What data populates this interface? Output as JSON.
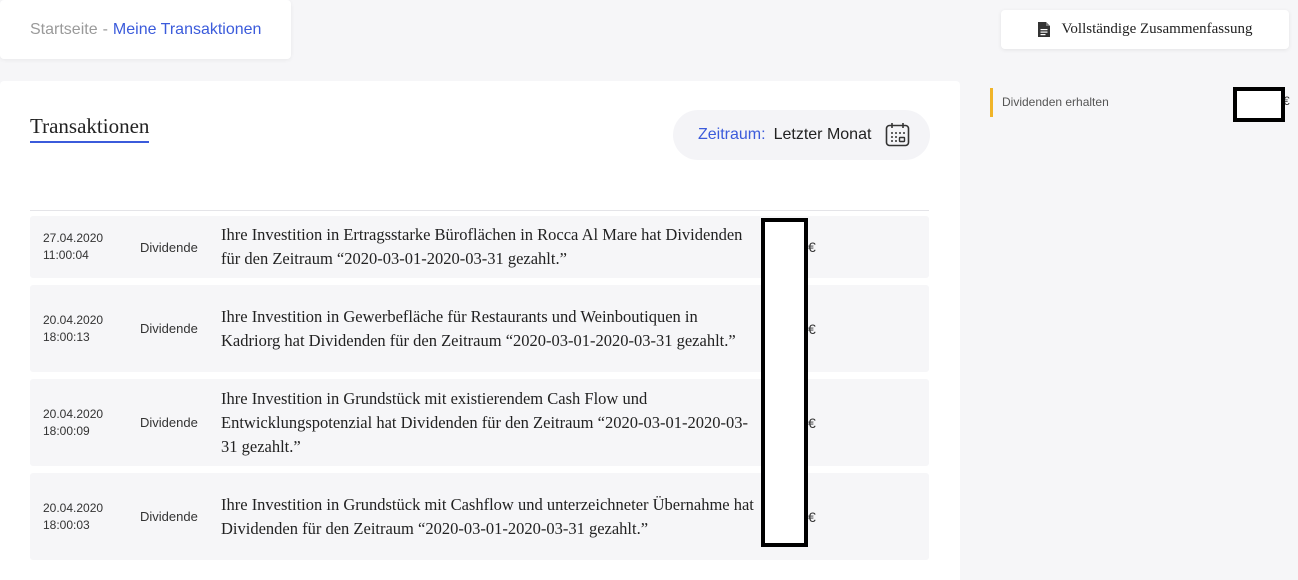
{
  "breadcrumb": {
    "home": "Startseite",
    "separator": "-",
    "current": "Meine Transaktionen"
  },
  "summary_button": {
    "label": "Vollständige Zusammenfassung",
    "icon": "document-icon"
  },
  "main": {
    "title": "Transaktionen",
    "period": {
      "label": "Zeitraum:",
      "value": "Letzter Monat",
      "icon": "calendar-icon"
    },
    "transactions": [
      {
        "date": "27.04.2020",
        "time": "11:00:04",
        "type": "Dividende",
        "description": "Ihre Investition in Ertragsstarke Büroflächen in Rocca Al Mare hat Dividenden für den Zeitraum “2020-03-01-2020-03-31 gezahlt.”",
        "currency": "€"
      },
      {
        "date": "20.04.2020",
        "time": "18:00:13",
        "type": "Dividende",
        "description": "Ihre Investition in Gewerbefläche für Restaurants und Weinboutiquen in Kadriorg hat Dividenden für den Zeitraum “2020-03-01-2020-03-31 gezahlt.”",
        "currency": "€"
      },
      {
        "date": "20.04.2020",
        "time": "18:00:09",
        "type": "Dividende",
        "description": "Ihre Investition in Grundstück mit existierendem Cash Flow und Entwicklungspotenzial hat Dividenden für den Zeitraum “2020-03-01-2020-03-31 gezahlt.”",
        "currency": "€"
      },
      {
        "date": "20.04.2020",
        "time": "18:00:03",
        "type": "Dividende",
        "description": "Ihre Investition in Grundstück mit Cashflow und unterzeichneter Übernahme hat Dividenden für den Zeitraum “2020-03-01-2020-03-31 gezahlt.”",
        "currency": "€"
      }
    ]
  },
  "sidebar": {
    "stat_label": "Dividenden erhalten",
    "stat_currency": "€"
  },
  "colors": {
    "accent": "#3b5bdb",
    "highlight": "#f0b429"
  }
}
